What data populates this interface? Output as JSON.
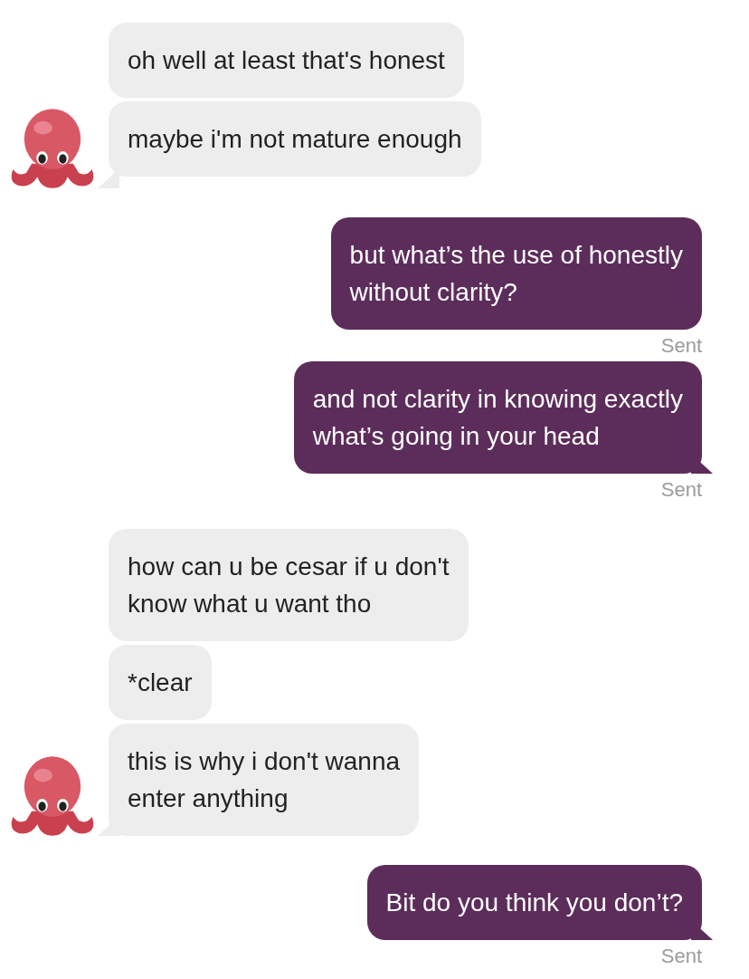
{
  "messages": [
    {
      "kind": "received",
      "lines": [
        "oh well at least that's honest"
      ],
      "avatar": false,
      "tail": false
    },
    {
      "kind": "received",
      "lines": [
        "maybe i'm not mature enough"
      ],
      "avatar": true,
      "tail": true
    },
    {
      "kind": "sent",
      "lines": [
        "but what’s the use of honestly",
        "without clarity?"
      ],
      "tail": false,
      "status": "Sent"
    },
    {
      "kind": "sent",
      "lines": [
        "and not clarity in knowing exactly",
        "what’s going in your head"
      ],
      "tail": true,
      "status": "Sent"
    },
    {
      "kind": "received",
      "lines": [
        "how can u be cesar if u don't",
        "know what u want tho"
      ],
      "avatar": false,
      "tail": false
    },
    {
      "kind": "received",
      "lines": [
        "*clear"
      ],
      "avatar": false,
      "tail": false
    },
    {
      "kind": "received",
      "lines": [
        "this is why i don't wanna",
        "enter anything"
      ],
      "avatar": true,
      "tail": true
    },
    {
      "kind": "sent",
      "lines": [
        "Bit do you think you don’t?"
      ],
      "tail": true,
      "status": "Sent"
    }
  ]
}
